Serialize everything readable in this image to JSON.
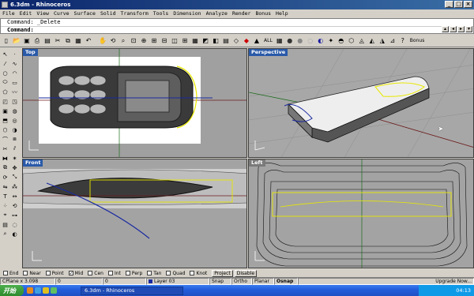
{
  "window": {
    "title": "6.3dm - Rhinoceros"
  },
  "menu": [
    "File",
    "Edit",
    "View",
    "Curve",
    "Surface",
    "Solid",
    "Transform",
    "Tools",
    "Dimension",
    "Analyze",
    "Render",
    "Bonus",
    "Help"
  ],
  "command": {
    "history": "Command: _Delete",
    "prompt": "Command:"
  },
  "toolbar": {
    "all_label": "ALL",
    "bonus_label": "Bonus"
  },
  "viewports": {
    "top": {
      "title": "Top"
    },
    "perspective": {
      "title": "Perspective"
    },
    "front": {
      "title": "Front"
    },
    "left": {
      "title": "Left"
    }
  },
  "osnap": {
    "items": [
      {
        "label": "End",
        "checked": false
      },
      {
        "label": "Near",
        "checked": false
      },
      {
        "label": "Point",
        "checked": false
      },
      {
        "label": "Mid",
        "checked": true
      },
      {
        "label": "Cen",
        "checked": false
      },
      {
        "label": "Int",
        "checked": false
      },
      {
        "label": "Perp",
        "checked": false
      },
      {
        "label": "Tan",
        "checked": false
      },
      {
        "label": "Quad",
        "checked": false
      },
      {
        "label": "Knot",
        "checked": false
      }
    ],
    "project_label": "Project",
    "disable_label": "Disable"
  },
  "status": {
    "cplane": "CPlane x 3.098",
    "y": "0",
    "z": "0",
    "layer": "Layer 03",
    "snap": "Snap",
    "ortho": "Ortho",
    "planar": "Planar",
    "osnap": "Osnap",
    "upgrade": "Upgrade Now..."
  },
  "taskbar": {
    "start": "开始",
    "item": "6.3dm - Rhinoceros",
    "clock": "04:13"
  },
  "colors": {
    "title_gradient_start": "#0a246a",
    "viewport_active": "#2a5aa8",
    "curve_yellow": "#e8e800",
    "curve_blue": "#1a2aa0"
  }
}
